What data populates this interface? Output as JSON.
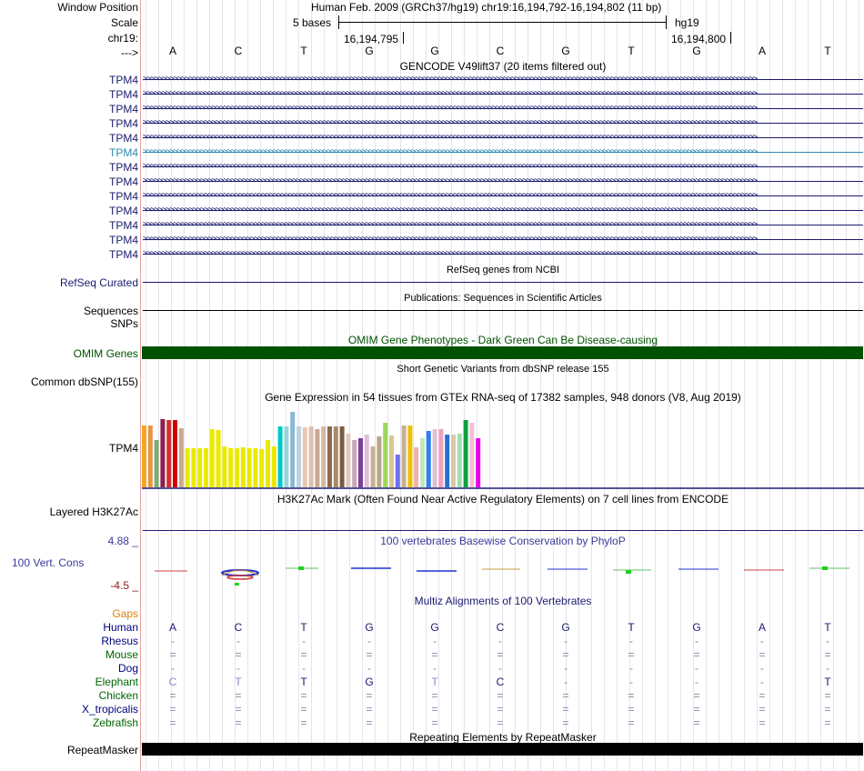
{
  "header": {
    "window_position_label": "Window Position",
    "position_text": "Human Feb. 2009 (GRCh37/hg19)   chr19:16,194,792-16,194,802 (11 bp)",
    "scale_label": "Scale",
    "scale_bases": "5 bases",
    "assembly": "hg19",
    "chrom_label": "chr19:",
    "tick_left": "16,194,795",
    "tick_right": "16,194,800",
    "strand_label": "--->",
    "bases": [
      "A",
      "C",
      "T",
      "G",
      "G",
      "C",
      "G",
      "T",
      "G",
      "A",
      "T"
    ]
  },
  "gencode": {
    "title": "GENCODE V49lift37 (20 items filtered out)",
    "items": [
      "TPM4",
      "TPM4",
      "TPM4",
      "TPM4",
      "TPM4",
      "TPM4",
      "TPM4",
      "TPM4",
      "TPM4",
      "TPM4",
      "TPM4",
      "TPM4",
      "TPM4"
    ],
    "highlight_index": 5
  },
  "refseq": {
    "title": "RefSeq genes from NCBI",
    "label": "RefSeq Curated"
  },
  "publications": {
    "title": "Publications: Sequences in Scientific Articles",
    "label": "Sequences"
  },
  "snps": {
    "label": "SNPs"
  },
  "omim": {
    "title": "OMIM Gene Phenotypes - Dark Green Can Be Disease-causing",
    "label": "OMIM Genes",
    "color": "#005200"
  },
  "dbsnp": {
    "title": "Short Genetic Variants from dbSNP release 155",
    "label": "Common dbSNP(155)"
  },
  "gtex": {
    "title": "Gene Expression in 54 tissues from GTEx RNA-seq of 17382 samples, 948 donors (V8, Aug 2019)",
    "label": "TPM4",
    "bar_levels": [
      0.76,
      0.76,
      0.58,
      0.83,
      0.82,
      0.82,
      0.72,
      0.48,
      0.48,
      0.48,
      0.48,
      0.71,
      0.7,
      0.5,
      0.48,
      0.48,
      0.49,
      0.48,
      0.48,
      0.47,
      0.58,
      0.5,
      0.74,
      0.74,
      0.92,
      0.74,
      0.73,
      0.74,
      0.71,
      0.74,
      0.74,
      0.74,
      0.74,
      0.66,
      0.58,
      0.6,
      0.64,
      0.5,
      0.62,
      0.79,
      0.63,
      0.4,
      0.76,
      0.76,
      0.49,
      0.6,
      0.69,
      0.71,
      0.71,
      0.64,
      0.64,
      0.66,
      0.82,
      0.79,
      0.6
    ],
    "bar_colors": [
      "#f5a623",
      "#e89447",
      "#7fad6f",
      "#8b1f4f",
      "#d32f2f",
      "#d10000",
      "#c9a98c",
      "#eaea00",
      "#eaea00",
      "#eaea00",
      "#eaea00",
      "#eaea00",
      "#eaea00",
      "#eaea00",
      "#eaea00",
      "#eaea00",
      "#eaea00",
      "#eaea00",
      "#eaea00",
      "#eaea00",
      "#eaea00",
      "#e8e800",
      "#00c8c8",
      "#9ad5d5",
      "#8ab8d8",
      "#c1d0e0",
      "#e8c8b0",
      "#dcc0b0",
      "#c8a890",
      "#d8b8a0",
      "#8b6a4a",
      "#a88a6a",
      "#7a5a40",
      "#e0c8c0",
      "#c8a8b8",
      "#7e3f98",
      "#e0c0d8",
      "#c8b090",
      "#b8a888",
      "#9ed85a",
      "#d8c890",
      "#7070f0",
      "#c8b090",
      "#f0c000",
      "#f0b0b0",
      "#c0e8c0",
      "#3080f0",
      "#e0c0d0",
      "#f0a0c0",
      "#2870d0",
      "#d8c8a8",
      "#a0e0b0",
      "#10a040",
      "#f0c0d8",
      "#ec00ec"
    ]
  },
  "h3k27ac": {
    "title": "H3K27Ac Mark (Often Found Near Active Regulatory Elements) on 7 cell lines from ENCODE",
    "label": "Layered H3K27Ac"
  },
  "phylop": {
    "title": "100 vertebrates Basewise Conservation by PhyloP",
    "label": "100 Vert. Cons",
    "max": "4.88 _",
    "min": "-4.5 _"
  },
  "multiz": {
    "title": "Multiz Alignments of 100 Vertebrates",
    "gaps_label": "Gaps",
    "species": [
      {
        "name": "Human",
        "color": "#000080",
        "row": [
          "A",
          "C",
          "T",
          "G",
          "G",
          "C",
          "G",
          "T",
          "G",
          "A",
          "T"
        ]
      },
      {
        "name": "Rhesus",
        "color": "#000080",
        "row": [
          "-",
          "-",
          "-",
          "-",
          "-",
          "-",
          "-",
          "-",
          "-",
          "-",
          "-"
        ]
      },
      {
        "name": "Mouse",
        "color": "#006400",
        "row": [
          "=",
          "=",
          "=",
          "=",
          "=",
          "=",
          "=",
          "=",
          "=",
          "=",
          "="
        ]
      },
      {
        "name": "Dog",
        "color": "#000080",
        "row": [
          "-",
          "-",
          "-",
          "-",
          "-",
          "-",
          "-",
          "-",
          "-",
          "-",
          "-"
        ]
      },
      {
        "name": "Elephant",
        "color": "#006400",
        "row": [
          "C",
          "T",
          "T",
          "G",
          "T",
          "C",
          "-",
          "-",
          "-",
          "-",
          "T"
        ]
      },
      {
        "name": "Chicken",
        "color": "#006400",
        "row": [
          "=",
          "=",
          "=",
          "=",
          "=",
          "=",
          "=",
          "=",
          "=",
          "=",
          "="
        ]
      },
      {
        "name": "X_tropicalis",
        "color": "#000080",
        "row": [
          "=",
          "=",
          "=",
          "=",
          "=",
          "=",
          "=",
          "=",
          "=",
          "=",
          "="
        ]
      },
      {
        "name": "Zebrafish",
        "color": "#006400",
        "row": [
          "=",
          "=",
          "=",
          "=",
          "=",
          "=",
          "=",
          "=",
          "=",
          "=",
          "="
        ]
      }
    ]
  },
  "repeatmasker": {
    "title": "Repeating Elements by RepeatMasker",
    "label": "RepeatMasker"
  }
}
